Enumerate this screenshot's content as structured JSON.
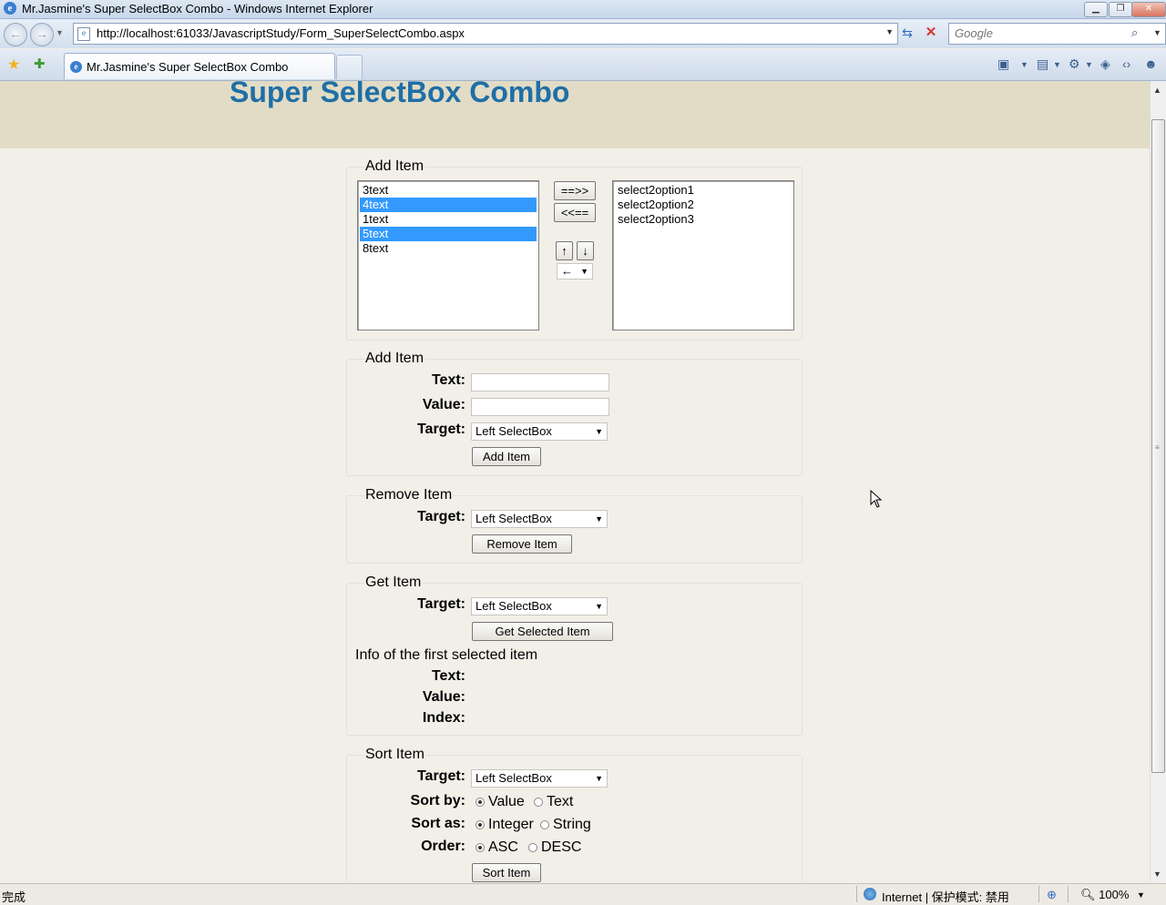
{
  "window": {
    "title": "Mr.Jasmine's Super SelectBox Combo - Windows Internet Explorer",
    "minimize": "▁",
    "restore": "❐",
    "close": "✕"
  },
  "addressbar": {
    "url": "http://localhost:61033/JavascriptStudy/Form_SuperSelectCombo.aspx",
    "search_placeholder": "Google"
  },
  "tabs": [
    {
      "label": "Mr.Jasmine's Super SelectBox Combo"
    }
  ],
  "page": {
    "title": "Super SelectBox Combo",
    "transfer": {
      "legend": "Add Item",
      "left_options": [
        {
          "text": "3text",
          "selected": false
        },
        {
          "text": "4text",
          "selected": true
        },
        {
          "text": "1text",
          "selected": false
        },
        {
          "text": "5text",
          "selected": true
        },
        {
          "text": "8text",
          "selected": false
        }
      ],
      "right_options": [
        {
          "text": "select2option1",
          "selected": false
        },
        {
          "text": "select2option2",
          "selected": false
        },
        {
          "text": "select2option3",
          "selected": false
        }
      ],
      "move_right_label": "==>>",
      "move_left_label": "<<==",
      "move_up_label": "↑",
      "move_down_label": "↓",
      "direction_value": "←"
    },
    "add_item": {
      "legend": "Add Item",
      "text_label": "Text:",
      "value_label": "Value:",
      "target_label": "Target:",
      "target_value": "Left SelectBox",
      "button_label": "Add Item"
    },
    "remove_item": {
      "legend": "Remove Item",
      "target_label": "Target:",
      "target_value": "Left SelectBox",
      "button_label": "Remove Item"
    },
    "get_item": {
      "legend": "Get Item",
      "target_label": "Target:",
      "target_value": "Left SelectBox",
      "button_label": "Get Selected Item",
      "info_heading": "Info of the first selected item",
      "text_label": "Text:",
      "value_label": "Value:",
      "index_label": "Index:"
    },
    "sort_item": {
      "legend": "Sort Item",
      "target_label": "Target:",
      "target_value": "Left SelectBox",
      "sort_by_label": "Sort by:",
      "sort_by_options": [
        "Value",
        "Text"
      ],
      "sort_as_label": "Sort as:",
      "sort_as_options": [
        "Integer",
        "String"
      ],
      "order_label": "Order:",
      "order_options": [
        "ASC",
        "DESC"
      ],
      "button_label": "Sort Item"
    }
  },
  "statusbar": {
    "status": "完成",
    "zone": "Internet | 保护模式: 禁用",
    "zoom": "100%"
  }
}
